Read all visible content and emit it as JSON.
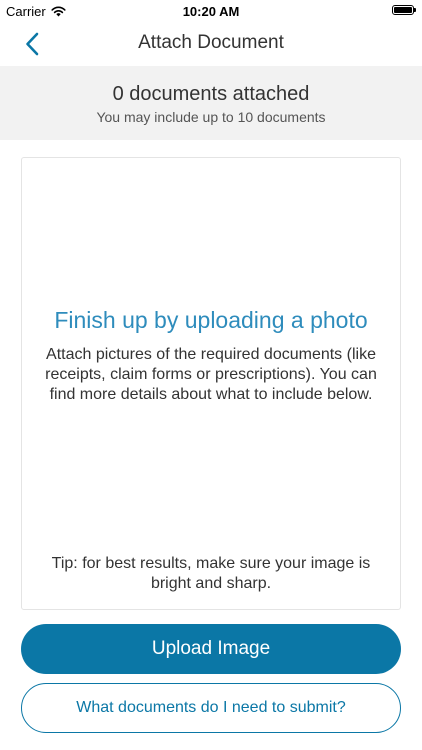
{
  "status_bar": {
    "carrier": "Carrier",
    "time": "10:20 AM"
  },
  "nav": {
    "title": "Attach Document",
    "back_icon": "chevron-left-icon"
  },
  "summary": {
    "count_text": "0 documents attached",
    "limit_text": "You may include up to 10 documents"
  },
  "card": {
    "heading": "Finish up by uploading a photo",
    "body": "Attach pictures of the required documents (like receipts, claim forms or prescriptions). You can find more details about what to include below.",
    "tip": "Tip: for best results, make sure your image is bright and sharp."
  },
  "actions": {
    "upload_label": "Upload Image",
    "help_label": "What documents do I need to submit?"
  },
  "colors": {
    "accent": "#0b77a6",
    "heading": "#2e8cbc",
    "band": "#f2f2f2"
  }
}
